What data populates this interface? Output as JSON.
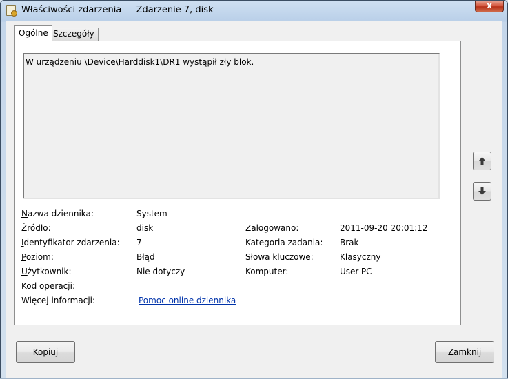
{
  "window": {
    "title": "Właściwości zdarzenia — Zdarzenie 7, disk",
    "close_label": "x"
  },
  "tabs": [
    {
      "label": "Ogólne",
      "active": true
    },
    {
      "label": "Szczegóły",
      "active": false
    }
  ],
  "description": "W urządzeniu \\Device\\Harddisk1\\DR1 wystąpił zły blok.",
  "fields": {
    "log_name": {
      "label": "Nazwa dziennika:",
      "value": "System"
    },
    "source": {
      "label": "Źródło:",
      "value": "disk"
    },
    "logged": {
      "label": "Zalogowano:",
      "value": "2011-09-20 20:01:12"
    },
    "event_id": {
      "label": "Identyfikator zdarzenia:",
      "value": "7"
    },
    "task_category": {
      "label": "Kategoria zadania:",
      "value": "Brak"
    },
    "level": {
      "label": "Poziom:",
      "value": "Błąd"
    },
    "keywords": {
      "label": "Słowa kluczowe:",
      "value": "Klasyczny"
    },
    "user": {
      "label": "Użytkownik:",
      "value": "Nie dotyczy"
    },
    "computer": {
      "label": "Komputer:",
      "value": "User-PC"
    },
    "opcode": {
      "label": "Kod operacji:",
      "value": ""
    },
    "more_info": {
      "label": "Więcej informacji:",
      "link": "Pomoc online dziennika"
    }
  },
  "buttons": {
    "copy": "Kopiuj",
    "close": "Zamknij"
  },
  "icons": {
    "prev": "arrow-up-icon",
    "next": "arrow-down-icon"
  }
}
